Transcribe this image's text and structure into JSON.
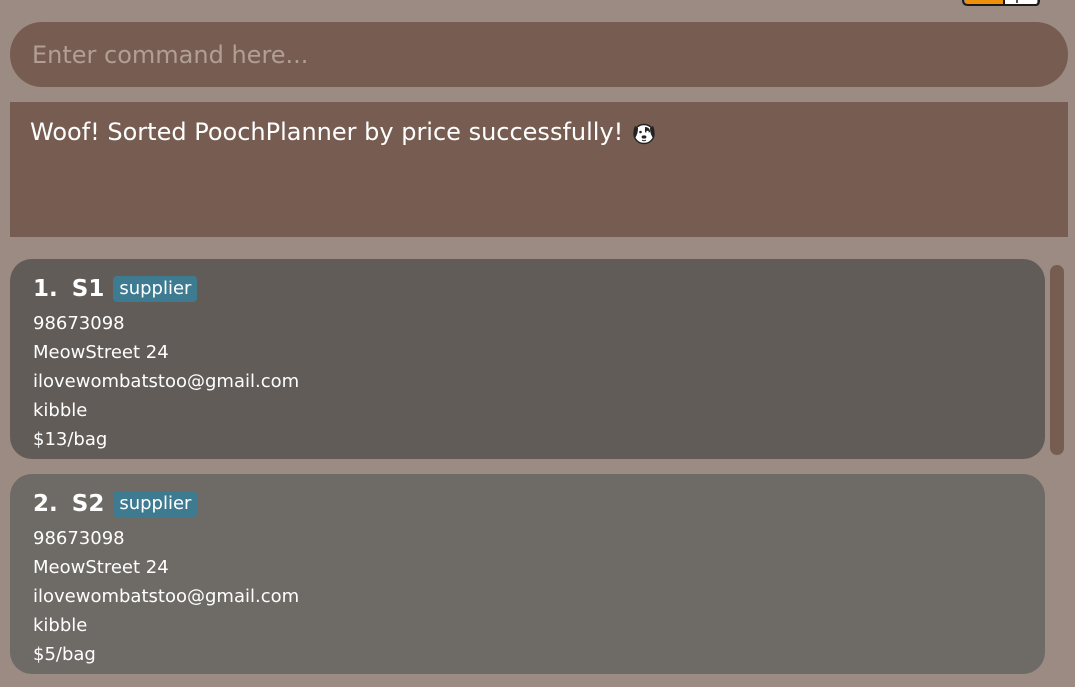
{
  "command": {
    "placeholder": "Enter command here...",
    "value": ""
  },
  "result": {
    "message": "Woof! Sorted PoochPlanner by price successfully!",
    "icon": "dog-face-icon"
  },
  "contacts": [
    {
      "index": "1.",
      "name": "S1",
      "tag": "supplier",
      "phone": "98673098",
      "address": "MeowStreet 24",
      "email": "ilovewombatstoo@gmail.com",
      "product": "kibble",
      "price": "$13/bag"
    },
    {
      "index": "2.",
      "name": "S2",
      "tag": "supplier",
      "phone": "98673098",
      "address": "MeowStreet 24",
      "email": "ilovewombatstoo@gmail.com",
      "product": "kibble",
      "price": "$5/bag"
    }
  ],
  "colors": {
    "background": "#9c8b83",
    "panel": "#775d51",
    "card_primary": "#615c58",
    "card_secondary": "#6e6a66",
    "tag": "#3e7b91",
    "logo_orange": "#f0900a"
  }
}
